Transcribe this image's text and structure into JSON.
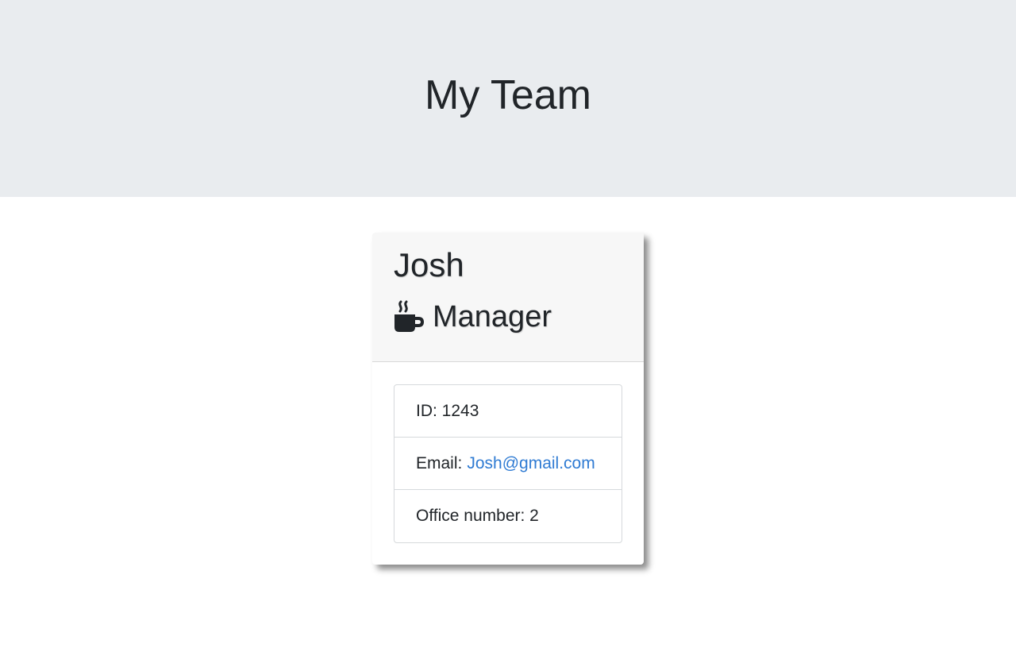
{
  "header": {
    "title": "My Team"
  },
  "employee_card": {
    "name": "Josh",
    "role": "Manager",
    "role_icon": "mug-hot-icon",
    "id_label": "ID: 1243",
    "email_label": "Email:",
    "email": "Josh@gmail.com",
    "office_label": "Office number: 2"
  },
  "colors": {
    "header_bg": "#e9ecef",
    "card_header_bg": "#f7f7f7",
    "link": "#2f7bd3",
    "text": "#212529"
  }
}
